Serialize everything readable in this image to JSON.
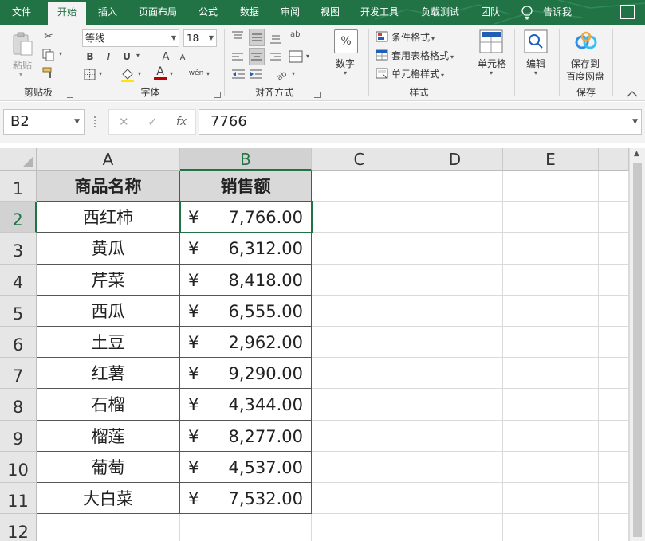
{
  "ribbon_tabs": {
    "file": "文件",
    "home": "开始",
    "insert": "插入",
    "page_layout": "页面布局",
    "formulas": "公式",
    "data": "数据",
    "review": "审阅",
    "view": "视图",
    "developer": "开发工具",
    "load_test": "负载测试",
    "team": "团队",
    "tell_me": "告诉我"
  },
  "clipboard": {
    "paste_label": "粘贴",
    "group_label": "剪贴板"
  },
  "font": {
    "family": "等线",
    "size": "18",
    "bold": "B",
    "italic": "I",
    "underline": "U",
    "grow": "A",
    "shrink": "A",
    "font_color_glyph": "A",
    "phonetic_glyph": "wén",
    "group_label": "字体"
  },
  "alignment": {
    "wrap_glyph": "ab",
    "group_label": "对齐方式"
  },
  "number": {
    "percent_glyph": "%",
    "label": "数字"
  },
  "styles": {
    "conditional": "条件格式",
    "table_format": "套用表格格式",
    "cell_styles": "单元格样式",
    "group_label": "样式"
  },
  "cells": {
    "label": "单元格"
  },
  "editing": {
    "label": "编辑"
  },
  "save": {
    "line1": "保存到",
    "line2": "百度网盘",
    "group_label": "保存"
  },
  "formula_bar": {
    "name_box": "B2",
    "cancel_glyph": "✕",
    "enter_glyph": "✓",
    "fx_glyph": "fx",
    "content": "7766"
  },
  "sheet": {
    "columns": [
      "A",
      "B",
      "C",
      "D",
      "E"
    ],
    "rows": [
      "1",
      "2",
      "3",
      "4",
      "5",
      "6",
      "7",
      "8",
      "9",
      "10",
      "11",
      "12"
    ],
    "selected_cell": "B2",
    "headers": [
      "商品名称",
      "销售额"
    ],
    "currency_symbol": "¥",
    "records": [
      {
        "name": "西红柿",
        "amount": "7,766.00"
      },
      {
        "name": "黄瓜",
        "amount": "6,312.00"
      },
      {
        "name": "芹菜",
        "amount": "8,418.00"
      },
      {
        "name": "西瓜",
        "amount": "6,555.00"
      },
      {
        "name": "土豆",
        "amount": "2,962.00"
      },
      {
        "name": "红薯",
        "amount": "9,290.00"
      },
      {
        "name": "石榴",
        "amount": "4,344.00"
      },
      {
        "name": "榴莲",
        "amount": "8,277.00"
      },
      {
        "name": "葡萄",
        "amount": "4,537.00"
      },
      {
        "name": "大白菜",
        "amount": "7,532.00"
      }
    ]
  },
  "colors": {
    "excel_green": "#217346",
    "header_fill": "#d9d9d9",
    "ribbon_bg": "#f3f3f3"
  }
}
